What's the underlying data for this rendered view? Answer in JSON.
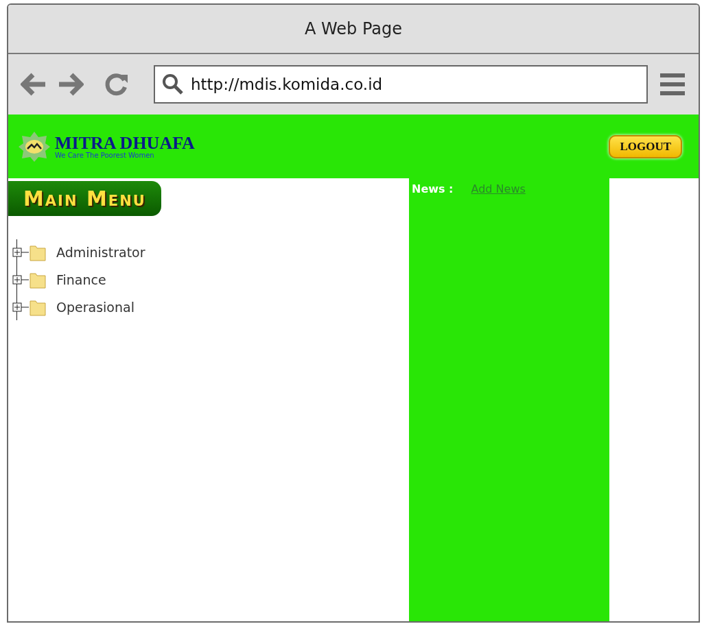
{
  "window": {
    "title": "A Web Page"
  },
  "address_bar": {
    "value": "http://mdis.komida.co.id"
  },
  "header": {
    "logo_title": "MITRA DHUAFA",
    "logo_tagline": "We Care The Poorest Women",
    "logout_button": "LOGOUT"
  },
  "main_menu": {
    "label": "Main Menu",
    "tree": [
      {
        "label": "Administrator",
        "expanded": false
      },
      {
        "label": "Finance",
        "expanded": false
      },
      {
        "label": "Operasional",
        "expanded": false
      }
    ]
  },
  "news": {
    "label": "News :",
    "link": "Add News"
  }
}
